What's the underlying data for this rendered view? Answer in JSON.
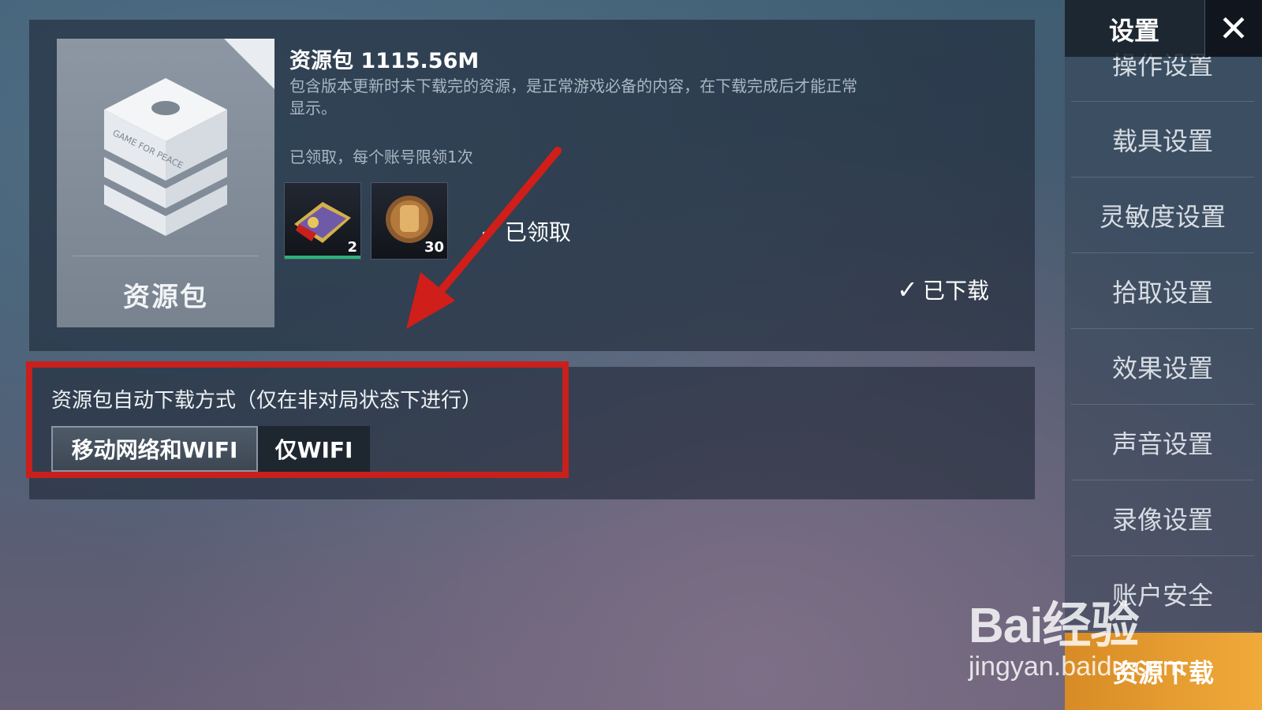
{
  "resource_pack": {
    "card_label": "资源包",
    "title_prefix": "资源包",
    "size": "1115.56M",
    "description": "包含版本更新时未下载完的资源，是正常游戏必备的内容，在下载完成后才能正常显示。",
    "claim_note": "已领取，每个账号限领1次",
    "rewards": [
      {
        "count": "2",
        "icon": "coupon-icon"
      },
      {
        "count": "30",
        "icon": "medal-icon"
      }
    ],
    "claimed_label": "已领取",
    "downloaded_label": "已下载",
    "box_logo": "GAME FOR PEACE"
  },
  "auto_download": {
    "title": "资源包自动下载方式（仅在非对局状态下进行）",
    "options": [
      {
        "label": "移动网络和WIFI",
        "selected": true
      },
      {
        "label": "仅WIFI",
        "selected": false
      }
    ]
  },
  "sidebar": {
    "title": "设置",
    "close_icon": "close-icon",
    "items": [
      {
        "label": "操作设置"
      },
      {
        "label": "载具设置"
      },
      {
        "label": "灵敏度设置"
      },
      {
        "label": "拾取设置"
      },
      {
        "label": "效果设置"
      },
      {
        "label": "声音设置"
      },
      {
        "label": "录像设置"
      },
      {
        "label": "账户安全"
      },
      {
        "label": "资源下载",
        "active": true
      }
    ]
  },
  "watermark": {
    "brand": "Bai经验",
    "url": "jingyan.baidu.com"
  },
  "colors": {
    "highlight": "#c8201c",
    "active_tab": "#f0aa3a"
  }
}
